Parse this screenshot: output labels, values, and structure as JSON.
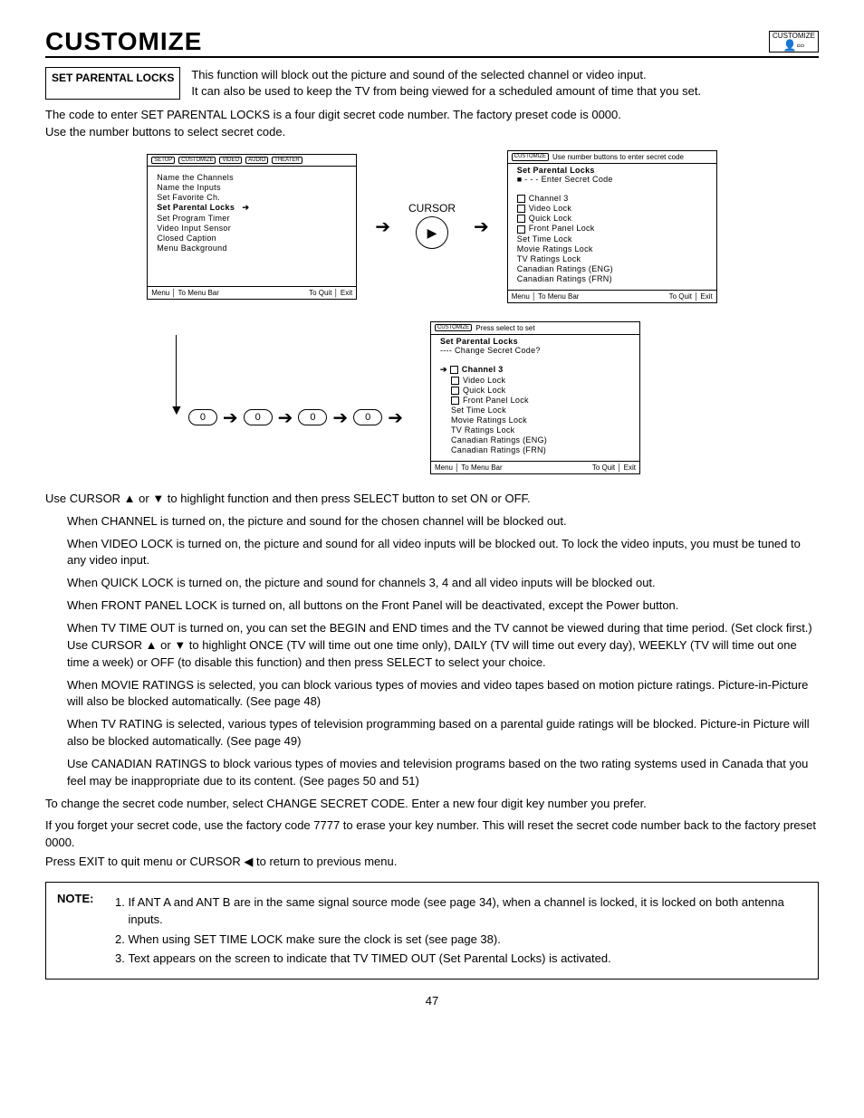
{
  "header": {
    "title": "CUSTOMIZE",
    "icon_label": "CUSTOMIZE"
  },
  "section_label": "SET PARENTAL LOCKS",
  "intro": {
    "line1": "This function will block out the picture and sound of the selected channel or video input.",
    "line2": "It can also be used to keep the TV from being viewed for a scheduled amount of time that you set."
  },
  "para1": "The code to enter SET PARENTAL LOCKS is a four digit secret code number.  The factory preset code is 0000.",
  "para1b": "Use the number buttons to select secret code.",
  "osd_tabs": [
    "SETUP",
    "CUSTOMIZE",
    "VIDEO",
    "AUDIO",
    "THEATER"
  ],
  "osd1": {
    "items": [
      "Name the Channels",
      "Name the Inputs",
      "Set Favorite Ch.",
      "Set Parental Locks",
      "Set Program Timer",
      "Video Input Sensor",
      "Closed Caption",
      "Menu Background"
    ],
    "selected_index": 3,
    "foot_menu": "Menu",
    "foot_center": "To Menu Bar",
    "foot_right": "To Quit",
    "foot_exit": "Exit"
  },
  "cursor_label": "CURSOR",
  "osd2": {
    "top_hint": "Use number buttons to enter secret code",
    "title": "Set Parental Locks",
    "subtitle": "■ - - -  Enter Secret Code",
    "items": [
      "Channel 3",
      "Video Lock",
      "Quick Lock",
      "Front Panel Lock",
      "Set Time Lock",
      "Movie Ratings Lock",
      "TV Ratings Lock",
      "Canadian Ratings (ENG)",
      "Canadian Ratings (FRN)"
    ],
    "checkbox_count": 4,
    "foot_menu": "Menu",
    "foot_center": "To Menu Bar",
    "foot_right": "To Quit",
    "foot_exit": "Exit"
  },
  "code_digits": [
    "0",
    "0",
    "0",
    "0"
  ],
  "osd3": {
    "top_hint": "Press select to set",
    "title": "Set Parental Locks",
    "subtitle": "----  Change Secret Code?",
    "items": [
      "Channel 3",
      "Video Lock",
      "Quick Lock",
      "Front Panel Lock",
      "Set Time Lock",
      "Movie Ratings Lock",
      "TV Ratings Lock",
      "Canadian Ratings (ENG)",
      "Canadian Ratings (FRN)"
    ],
    "selected_index": 0,
    "checkbox_count": 4,
    "foot_menu": "Menu",
    "foot_center": "To Menu Bar",
    "foot_right": "To Quit",
    "foot_exit": "Exit"
  },
  "instructions": {
    "lead": "Use CURSOR ▲ or ▼ to highlight function and then press SELECT button to set ON or OFF.",
    "p_channel": "When CHANNEL is turned on, the picture and sound for the chosen channel will be blocked out.",
    "p_video": "When VIDEO LOCK is turned on, the picture and sound for all video inputs will be blocked out. To lock the video inputs, you must be tuned to any video input.",
    "p_quick": "When QUICK LOCK is turned on, the picture and sound for channels 3, 4 and all video inputs will be blocked out.",
    "p_front": "When FRONT PANEL LOCK is turned on, all buttons on the Front Panel will be deactivated, except the Power button.",
    "p_timeout": "When TV TIME OUT is turned on, you can set the BEGIN and END times and the TV cannot be viewed during that time period. (Set clock first.) Use CURSOR ▲ or ▼ to highlight ONCE (TV will time out one time only), DAILY (TV will time out every day), WEEKLY (TV will time out one time a week) or OFF (to disable this function) and then press SELECT to select your choice.",
    "p_movie": "When MOVIE RATINGS is selected, you can block various types of movies and video tapes based on motion picture ratings.  Picture-in-Picture will also be blocked automatically. (See page 48)",
    "p_tv": "When TV RATING is selected, various types of television programming based on a parental guide ratings will be blocked.  Picture-in Picture will also be blocked automatically.  (See page 49)",
    "p_can": "Use CANADIAN RATINGS to block various types of movies and television programs based on the two rating systems used in Canada that you feel may be inappropriate due to its content.  (See pages 50 and 51)",
    "p_change": "To change the secret code number, select CHANGE SECRET CODE.  Enter a new four digit key number you prefer.",
    "p_forget": "If you forget your secret code, use the factory code 7777 to erase your key number. This will reset the secret code number back to the factory preset 0000.",
    "p_exit": "Press EXIT to quit menu or CURSOR ◀ to return to previous menu."
  },
  "note": {
    "label": "NOTE:",
    "items": [
      "If ANT A and ANT B are in the same signal source mode (see page 34), when a channel is locked, it is locked on both antenna inputs.",
      "When using SET TIME LOCK make sure the clock is set (see page 38).",
      "Text appears on the screen to indicate that TV TIMED OUT (Set Parental Locks) is activated."
    ]
  },
  "page_number": "47"
}
